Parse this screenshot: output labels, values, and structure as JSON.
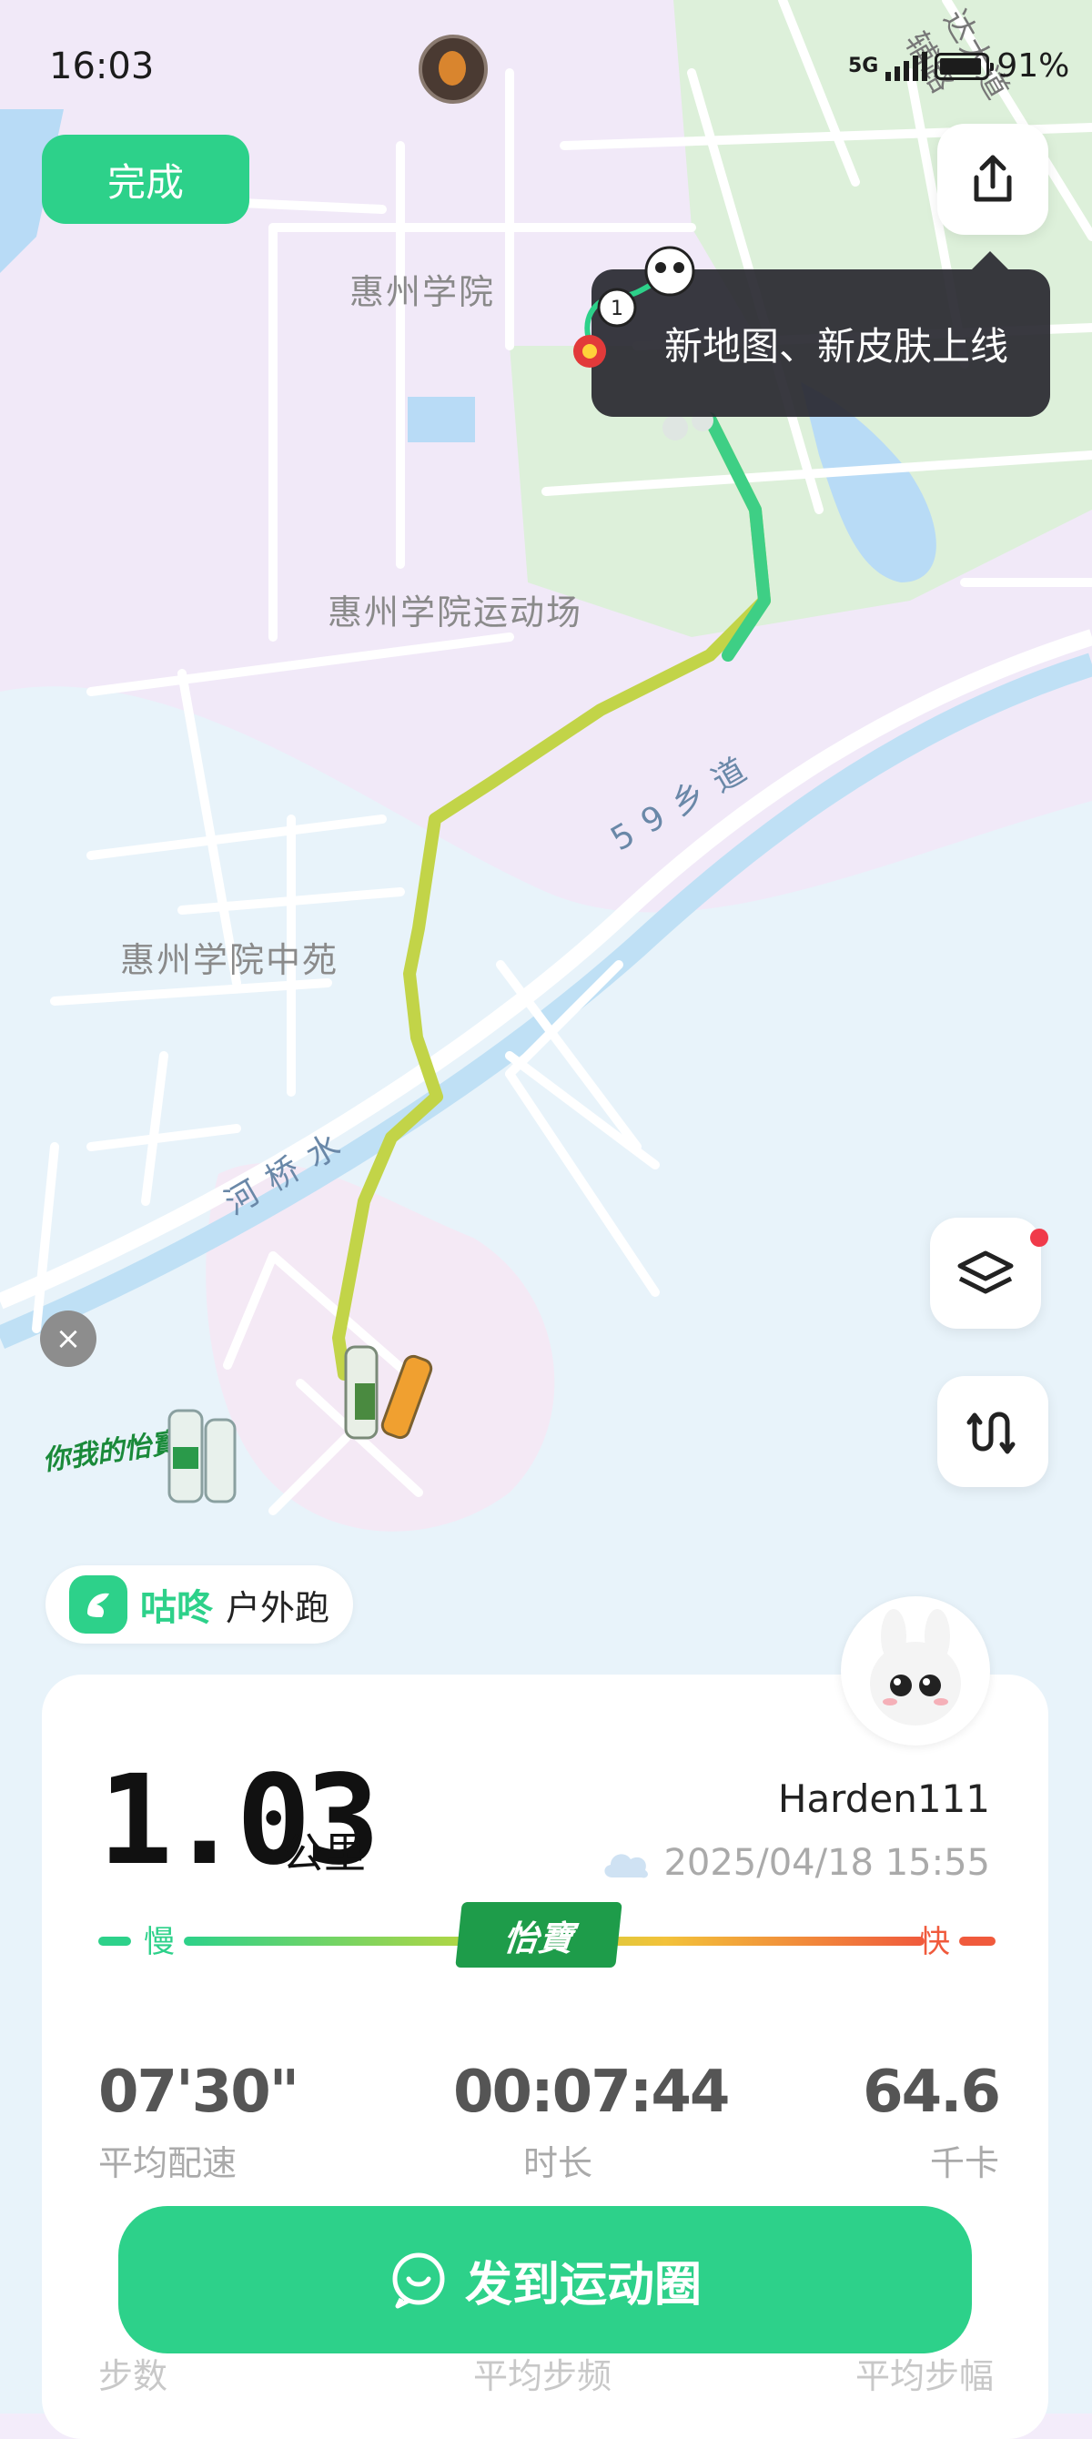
{
  "status_bar": {
    "time": "16:03",
    "network": "5G",
    "battery": "91%"
  },
  "toolbar": {
    "done_label": "完成"
  },
  "tooltip": {
    "text": "新地图、新皮肤上线"
  },
  "map": {
    "labels": {
      "college": "惠州学院",
      "stadium": "惠州学院运动场",
      "middle_garden": "惠州学院中苑",
      "road": "5 9 乡 道",
      "river": "河 桥 水",
      "corner_road": "达大道辅路"
    },
    "route_colors": {
      "fast": "#3ecf85",
      "slow": "#c2d448"
    }
  },
  "ad": {
    "close_label": "×",
    "brand_text": "你我的怡寶"
  },
  "app_tag": {
    "app_name": "咕咚",
    "activity": "户外跑"
  },
  "summary": {
    "distance": "1.03",
    "distance_unit": "公里",
    "username": "Harden111",
    "datetime": "2025/04/18 15:55",
    "pace_slow_label": "慢",
    "pace_fast_label": "快",
    "pace_brand": "怡寶"
  },
  "stats": [
    {
      "value": "07'30\"",
      "label": "平均配速"
    },
    {
      "value": "00:07:44",
      "label": "时长"
    },
    {
      "value": "64.6",
      "label": "千卡"
    }
  ],
  "stats_row2_labels": [
    "步数",
    "平均步频",
    "平均步幅"
  ],
  "share_button": {
    "label": "发到运动圈"
  },
  "colors": {
    "accent": "#2dd18a",
    "pace_slow": "#2dd18a",
    "pace_fast": "#f05a3c"
  }
}
